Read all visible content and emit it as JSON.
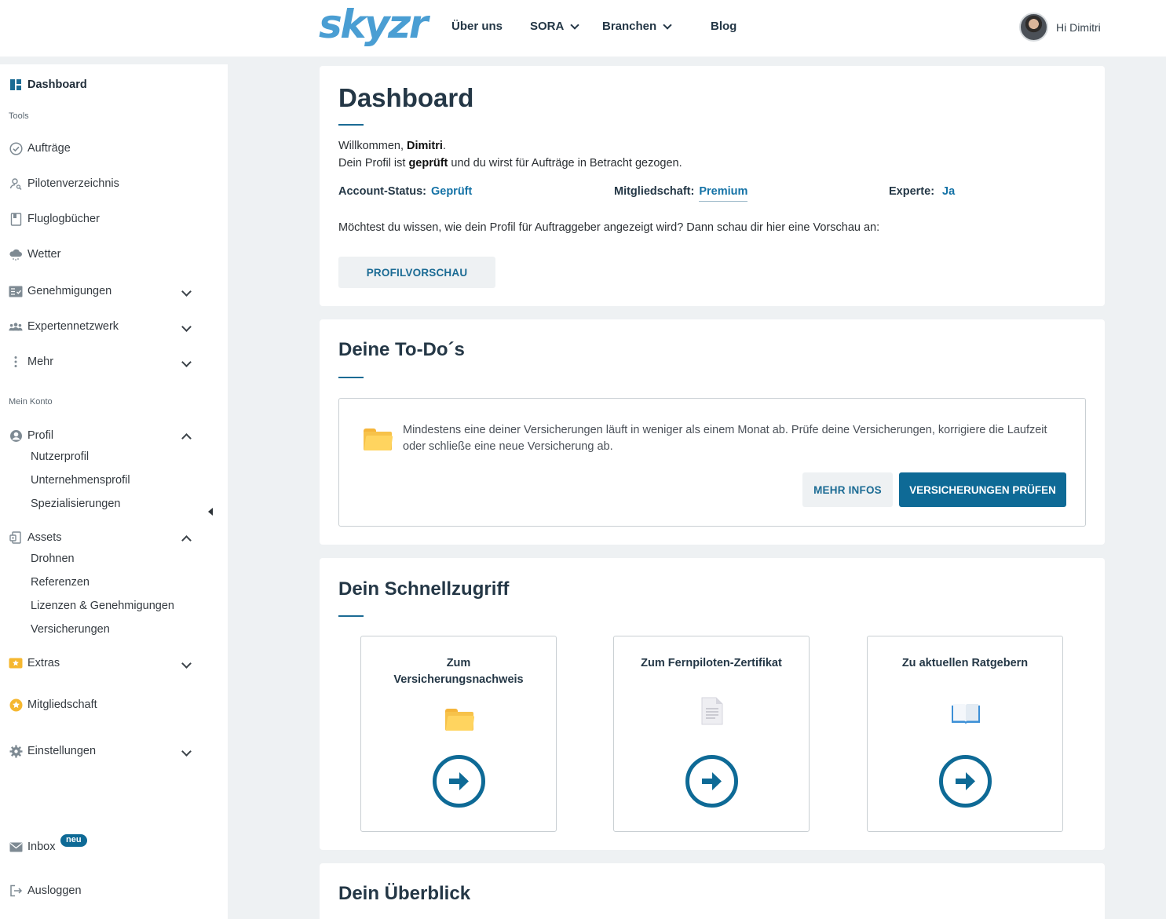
{
  "brand": {
    "logo_text": "skyzr",
    "accent": "#0e6a96",
    "logo_color": "#4a9ed3"
  },
  "topnav": {
    "items": [
      {
        "label": "Über uns",
        "dropdown": false
      },
      {
        "label": "SORA",
        "dropdown": true
      },
      {
        "label": "Branchen",
        "dropdown": true
      },
      {
        "label": "Blog",
        "dropdown": false
      }
    ],
    "greeting": "Hi Dimitri"
  },
  "sidebar": {
    "dashboard": "Dashboard",
    "section_tools": "Tools",
    "tools": [
      {
        "label": "Aufträge",
        "icon": "check-circle-icon"
      },
      {
        "label": "Pilotenverzeichnis",
        "icon": "user-search-icon"
      },
      {
        "label": "Fluglogbücher",
        "icon": "book-icon"
      },
      {
        "label": "Wetter",
        "icon": "cloud-icon"
      },
      {
        "label": "Genehmigungen",
        "icon": "checklist-icon"
      },
      {
        "label": "Expertennetzwerk",
        "icon": "users-icon"
      },
      {
        "label": "Mehr",
        "icon": "dots-vertical-icon"
      }
    ],
    "section_account": "Mein Konto",
    "profil": {
      "label": "Profil",
      "children": [
        "Nutzerprofil",
        "Unternehmensprofil",
        "Spezialisierungen"
      ]
    },
    "assets": {
      "label": "Assets",
      "children": [
        "Drohnen",
        "Referenzen",
        "Lizenzen & Genehmigungen",
        "Versicherungen"
      ]
    },
    "extras": "Extras",
    "mitgliedschaft": "Mitgliedschaft",
    "einstellungen": "Einstellungen",
    "inbox": "Inbox",
    "inbox_badge": "neu",
    "logout": "Ausloggen"
  },
  "dashboard": {
    "title": "Dashboard",
    "welcome_prefix": "Willkommen, ",
    "welcome_name": "Dimitri",
    "welcome_suffix": ".",
    "profile_prefix": "Dein Profil ist ",
    "profile_status": "geprüft",
    "profile_suffix": " und du wirst für Aufträge in Betracht gezogen.",
    "account_status_label": "Account-Status:",
    "account_status_value": "Geprüft",
    "membership_label": "Mitgliedschaft:",
    "membership_value": "Premium",
    "expert_label": "Experte:",
    "expert_value": "Ja",
    "preview_question": "Möchtest du wissen, wie dein Profil für Auftraggeber angezeigt wird? Dann schau dir hier eine Vorschau an:",
    "preview_button": "PROFILVORSCHAU"
  },
  "todos": {
    "title": "Deine To-Do´s",
    "item_text": "Mindestens eine deiner Versicherungen läuft in weniger als einem Monat ab. Prüfe deine Versicherungen, korrigiere die Laufzeit oder schließe eine neue Versicherung ab.",
    "more_button": "MEHR INFOS",
    "check_button": "VERSICHERUNGEN PRÜFEN"
  },
  "quickaccess": {
    "title": "Dein Schnellzugriff",
    "tiles": [
      {
        "label": "Zum Versicherungsnachweis",
        "icon": "folder-icon"
      },
      {
        "label": "Zum Fernpiloten-Zertifikat",
        "icon": "document-icon"
      },
      {
        "label": "Zu aktuellen Ratgebern",
        "icon": "open-book-icon"
      }
    ]
  },
  "overview": {
    "title": "Dein Überblick"
  }
}
